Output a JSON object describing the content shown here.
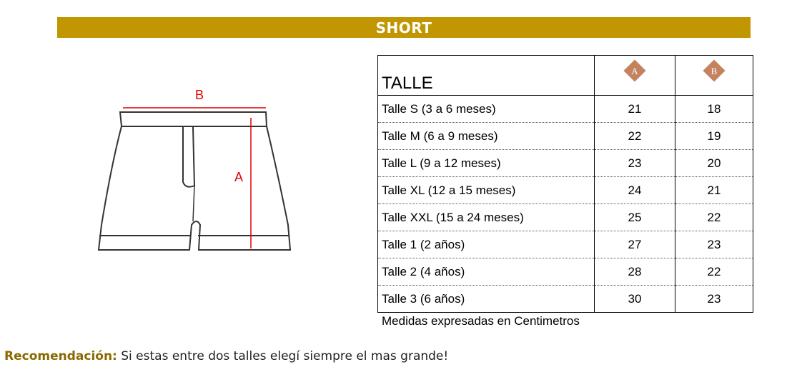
{
  "header": {
    "title": "SHORT"
  },
  "diagram": {
    "label_b": "B",
    "label_a": "A"
  },
  "table": {
    "header_label": "TALLE",
    "col_a": "A",
    "col_b": "B",
    "rows": [
      {
        "label": "Talle S (3 a 6 meses)",
        "a": "21",
        "b": "18"
      },
      {
        "label": "Talle M (6 a 9 meses)",
        "a": "22",
        "b": "19"
      },
      {
        "label": "Talle L (9 a 12 meses)",
        "a": "23",
        "b": "20"
      },
      {
        "label": "Talle XL (12 a 15 meses)",
        "a": "24",
        "b": "21"
      },
      {
        "label": "Talle XXL  (15 a 24 meses)",
        "a": "25",
        "b": "22"
      },
      {
        "label": "Talle 1  (2 años)",
        "a": "27",
        "b": "23"
      },
      {
        "label": "Talle 2  (4 años)",
        "a": "28",
        "b": "22"
      },
      {
        "label": "Talle 3  (6 años)",
        "a": "30",
        "b": "23"
      }
    ]
  },
  "note": "Medidas expresadas en Centimetros",
  "recommendation": {
    "label": "Recomendación:",
    "text": " Si estas entre dos talles elegí siempre el mas grande!"
  },
  "colors": {
    "banner": "#c19600",
    "diamond": "#c4825e",
    "measure_line": "#e00000"
  }
}
